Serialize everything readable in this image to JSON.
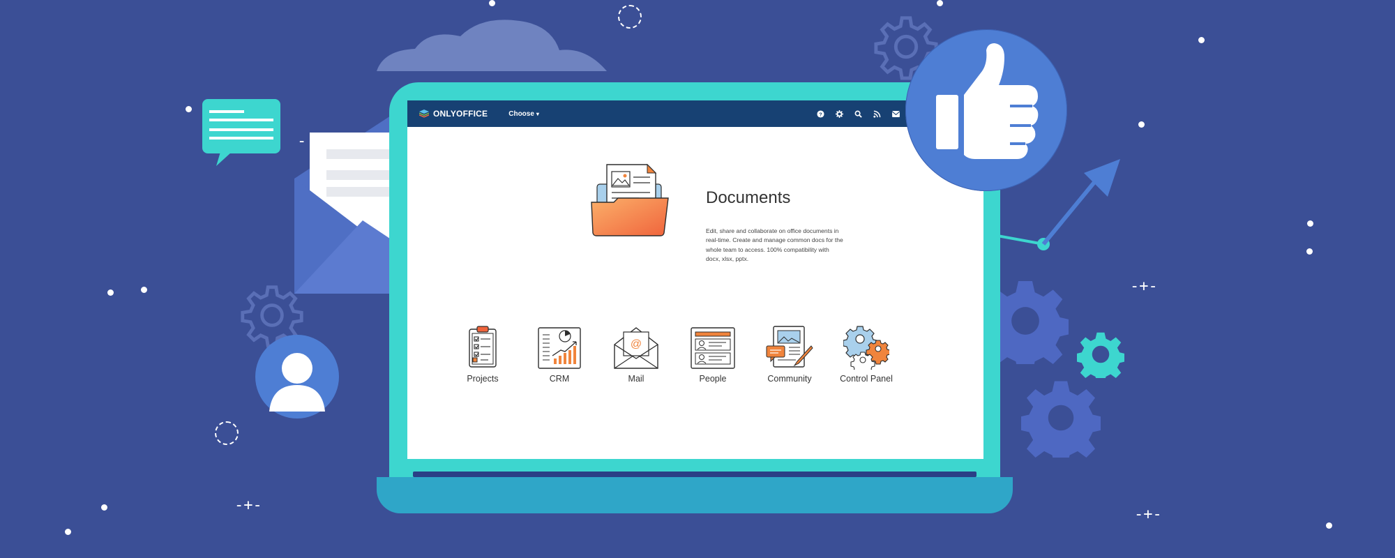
{
  "app": {
    "logo_text": "ONLYOFFICE",
    "choose_label": "Choose"
  },
  "header_icons": [
    "help-icon",
    "gear-icon",
    "search-icon",
    "feed-icon",
    "mail-icon",
    "chat-icon"
  ],
  "documents": {
    "title": "Documents",
    "description": "Edit, share and collaborate on office documents in real-time. Create and manage common docs for the whole team to access. 100% compatibility with docx, xlsx, pptx."
  },
  "modules": [
    {
      "label": "Projects",
      "icon": "clipboard-icon"
    },
    {
      "label": "CRM",
      "icon": "chart-icon"
    },
    {
      "label": "Mail",
      "icon": "envelope-icon"
    },
    {
      "label": "People",
      "icon": "contacts-icon"
    },
    {
      "label": "Community",
      "icon": "newsletter-icon"
    },
    {
      "label": "Control Panel",
      "icon": "gears-icon"
    }
  ],
  "colors": {
    "background": "#3b4f96",
    "laptop_frame": "#3dd6cf",
    "app_header": "#174173",
    "accent_orange": "#f0843c",
    "thumb_badge": "#4e7ed4"
  }
}
